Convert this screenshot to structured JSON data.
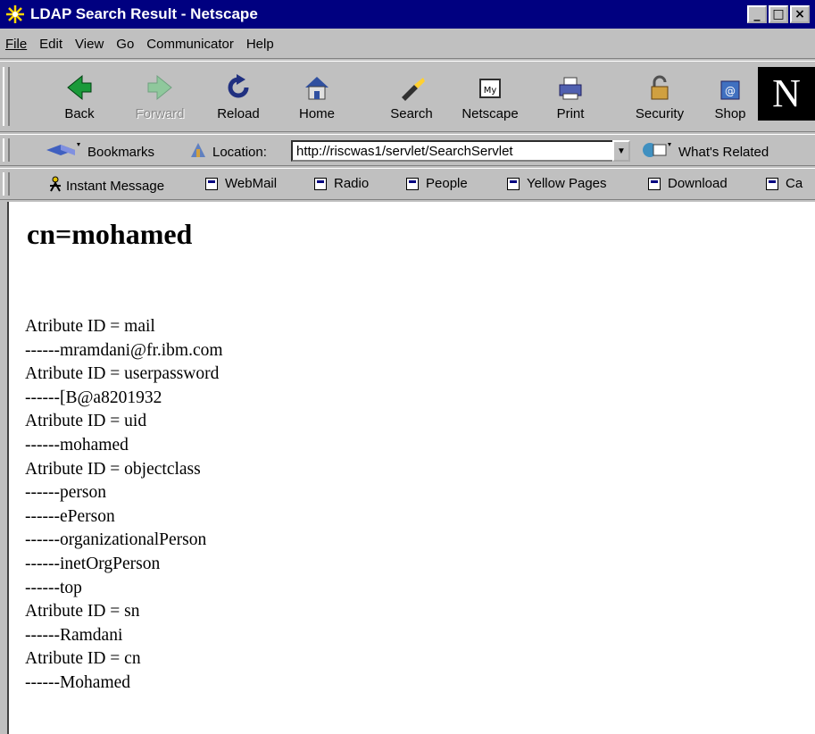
{
  "window": {
    "title": "LDAP Search Result - Netscape",
    "controls": [
      "_",
      "□",
      "×"
    ]
  },
  "menu": [
    "File",
    "Edit",
    "View",
    "Go",
    "Communicator",
    "Help"
  ],
  "nav_toolbar": {
    "back": "Back",
    "forward": "Forward",
    "reload": "Reload",
    "home": "Home",
    "search": "Search",
    "netscape": "Netscape",
    "print": "Print",
    "security": "Security",
    "shop": "Shop"
  },
  "location_toolbar": {
    "bookmarks": "Bookmarks",
    "location_label": "Location:",
    "url": "http://riscwas1/servlet/SearchServlet",
    "whats_related": "What's Related"
  },
  "personal_toolbar": [
    "Instant Message",
    "WebMail",
    "Radio",
    "People",
    "Yellow Pages",
    "Download",
    "Ca"
  ],
  "page": {
    "heading": "cn=mohamed",
    "lines": [
      "Atribute ID = mail",
      "------mramdani@fr.ibm.com",
      "Atribute ID = userpassword",
      "------[B@a8201932",
      "Atribute ID = uid",
      "------mohamed",
      "Atribute ID = objectclass",
      "------person",
      "------ePerson",
      "------organizationalPerson",
      "------inetOrgPerson",
      "------top",
      "Atribute ID = sn",
      "------Ramdani",
      "Atribute ID = cn",
      "------Mohamed"
    ]
  },
  "colors": {
    "titlebar": "#000080",
    "chrome": "#c0c0c0"
  }
}
